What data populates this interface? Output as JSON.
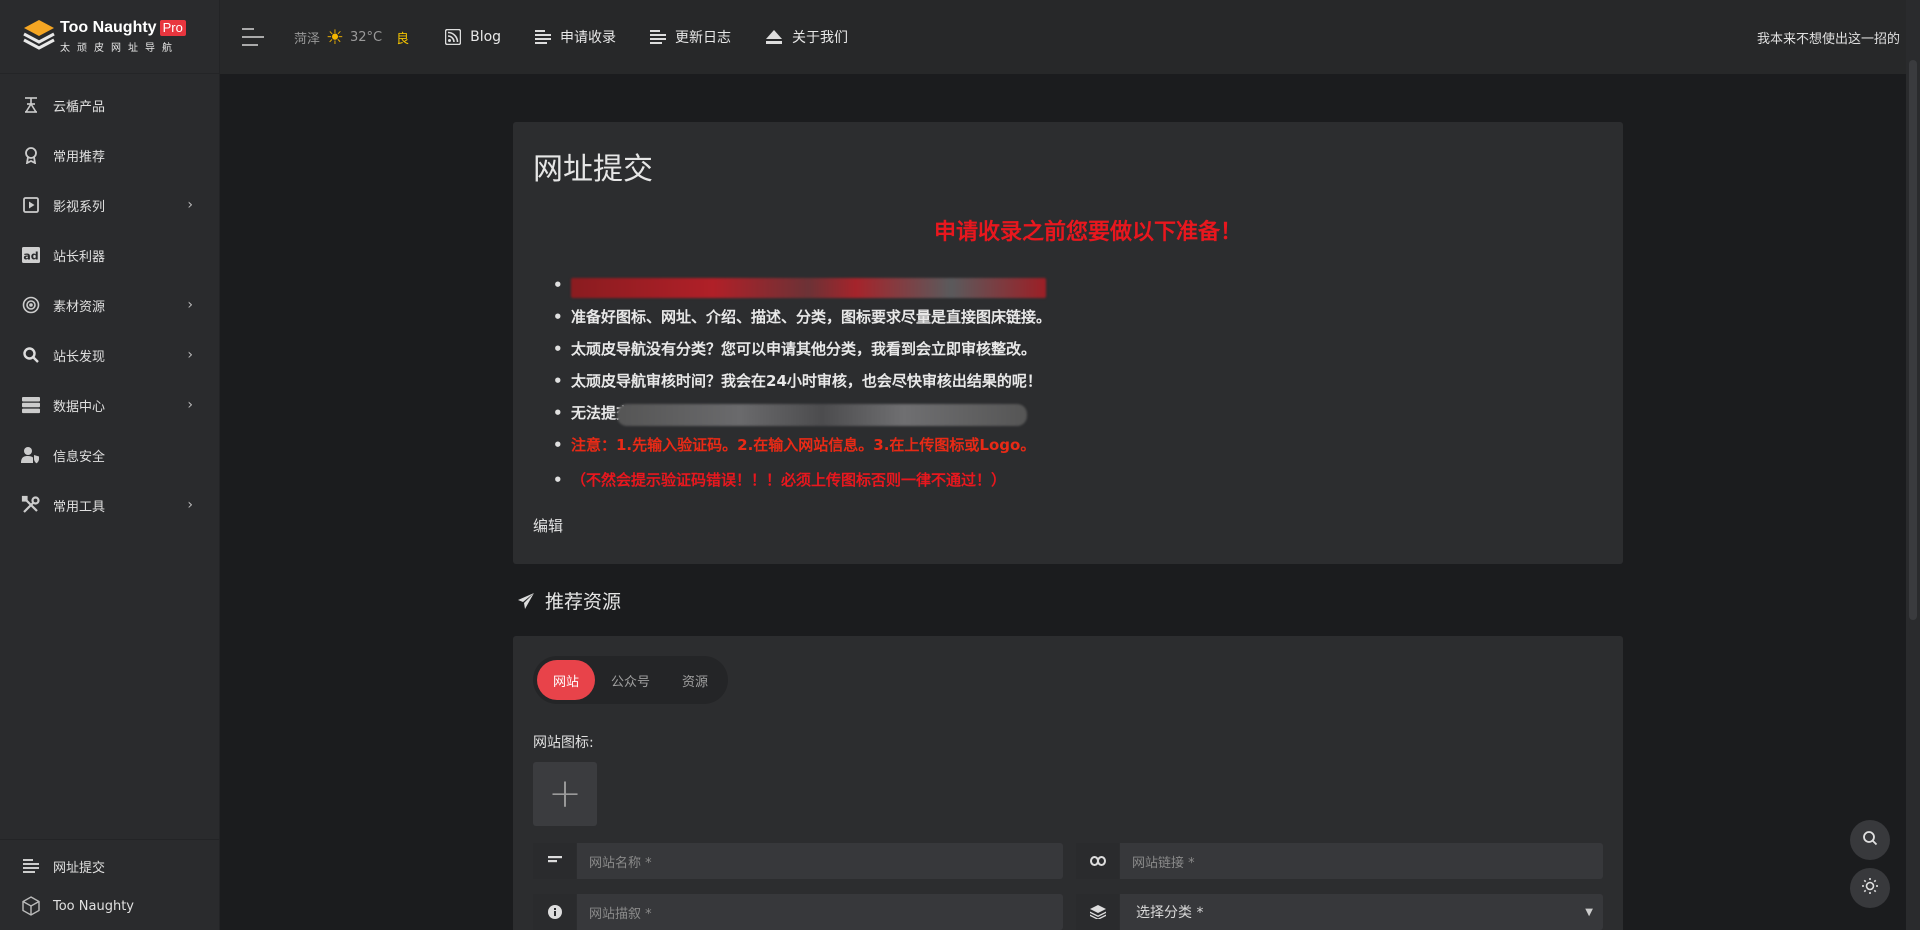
{
  "brand": {
    "title": "Too Naughty",
    "badge": "Pro",
    "subtitle": "太顽皮网址导航"
  },
  "sidebar": {
    "items": [
      {
        "label": "云楯产品",
        "icon": "tower-icon",
        "has_children": false
      },
      {
        "label": "常用推荐",
        "icon": "award-icon",
        "has_children": false
      },
      {
        "label": "影视系列",
        "icon": "play-box-icon",
        "has_children": true
      },
      {
        "label": "站长利器",
        "icon": "ad-icon",
        "has_children": false
      },
      {
        "label": "素材资源",
        "icon": "signal-icon",
        "has_children": true
      },
      {
        "label": "站长发现",
        "icon": "search-icon",
        "has_children": true
      },
      {
        "label": "数据中心",
        "icon": "server-icon",
        "has_children": true
      },
      {
        "label": "信息安全",
        "icon": "user-shield-icon",
        "has_children": false
      },
      {
        "label": "常用工具",
        "icon": "tools-icon",
        "has_children": true
      }
    ],
    "bottom": [
      {
        "label": "网址提交",
        "icon": "list-icon"
      },
      {
        "label": "Too Naughty",
        "icon": "logo-outline-icon"
      }
    ]
  },
  "topbar": {
    "weather": {
      "city": "菏泽",
      "temp": "32°C",
      "air_quality": "良"
    },
    "links": [
      {
        "label": "Blog",
        "icon": "rss-icon"
      },
      {
        "label": "申请收录",
        "icon": "lines-icon"
      },
      {
        "label": "更新日志",
        "icon": "lines-icon"
      },
      {
        "label": "关于我们",
        "icon": "eject-icon"
      }
    ],
    "right_text": "我本来不想使出这一招的"
  },
  "submit_card": {
    "title": "网址提交",
    "notice_heading": "申请收录之前您要做以下准备！",
    "tips": [
      "准备好图标、网址、介绍、描述、分类，图标要求尽量是直接图床链接。",
      "太顽皮导航没有分类？您可以申请其他分类，我看到会立即审核整改。",
      "太顽皮导航审核时间？我会在24小时审核，也会尽快审核出结果的呢！",
      "无法提交"
    ],
    "warning": "注意：1.先输入验证码。2.在输入网站信息。3.在上传图标或Logo。",
    "warning2": "（不然会提示验证码错误！！！必须上传图标否则一律不通过！）",
    "edit_label": "编辑"
  },
  "recommend": {
    "section_title": "推荐资源",
    "tabs": [
      "网站",
      "公众号",
      "资源"
    ],
    "active_tab": 0,
    "icon_label": "网站图标:",
    "fields": {
      "name_placeholder": "网站名称 *",
      "link_placeholder": "网站链接 *",
      "desc_placeholder": "网站描叙 *",
      "category_value": "选择分类 *"
    }
  },
  "colors": {
    "accent": "#e8434a",
    "notice_red": "#e8171e",
    "sun": "#f5b700"
  }
}
